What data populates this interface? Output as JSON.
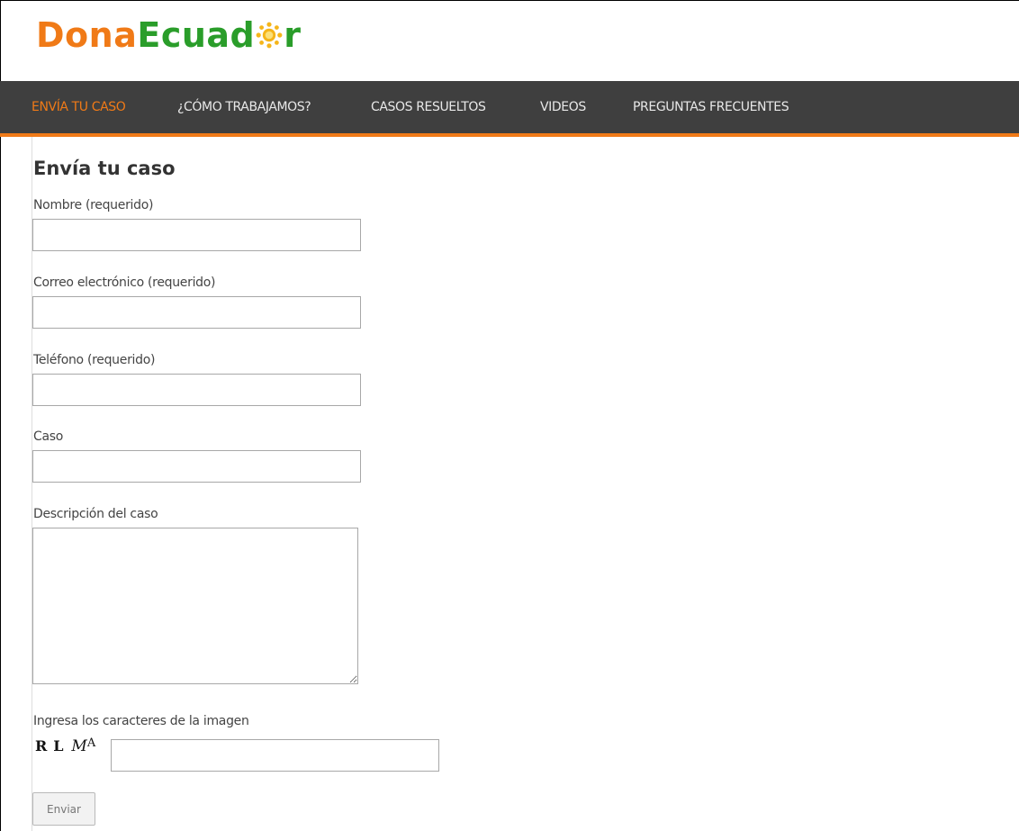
{
  "brand": {
    "part1": "Dona",
    "part2": "Ecuad",
    "part3": "r",
    "sun_icon": "sun-icon",
    "colors": {
      "orange": "#f07a17",
      "green": "#2a9d2a",
      "sun": "#f5b51a"
    }
  },
  "nav": {
    "items": [
      {
        "label": "ENVÍA TU CASO",
        "active": true
      },
      {
        "label": "¿CÓMO TRABAJAMOS?",
        "active": false
      },
      {
        "label": "CASOS RESUELTOS",
        "active": false
      },
      {
        "label": "VIDEOS",
        "active": false
      },
      {
        "label": "PREGUNTAS FRECUENTES",
        "active": false
      }
    ],
    "colors": {
      "background": "#3f3f3f",
      "accent": "#f07a17",
      "text": "#e8e8e8"
    }
  },
  "form": {
    "title": "Envía tu caso",
    "fields": [
      {
        "label": "Nombre (requerido)",
        "value": ""
      },
      {
        "label": "Correo electrónico (requerido)",
        "value": ""
      },
      {
        "label": "Teléfono (requerido)",
        "value": ""
      },
      {
        "label": "Caso",
        "value": ""
      },
      {
        "label": "Descripción del caso",
        "value": ""
      }
    ],
    "captcha": {
      "label": "Ingresa los caracteres de la imagen",
      "image_text": [
        "R",
        "L",
        "M",
        "A"
      ],
      "value": ""
    },
    "submit_label": "Enviar"
  }
}
